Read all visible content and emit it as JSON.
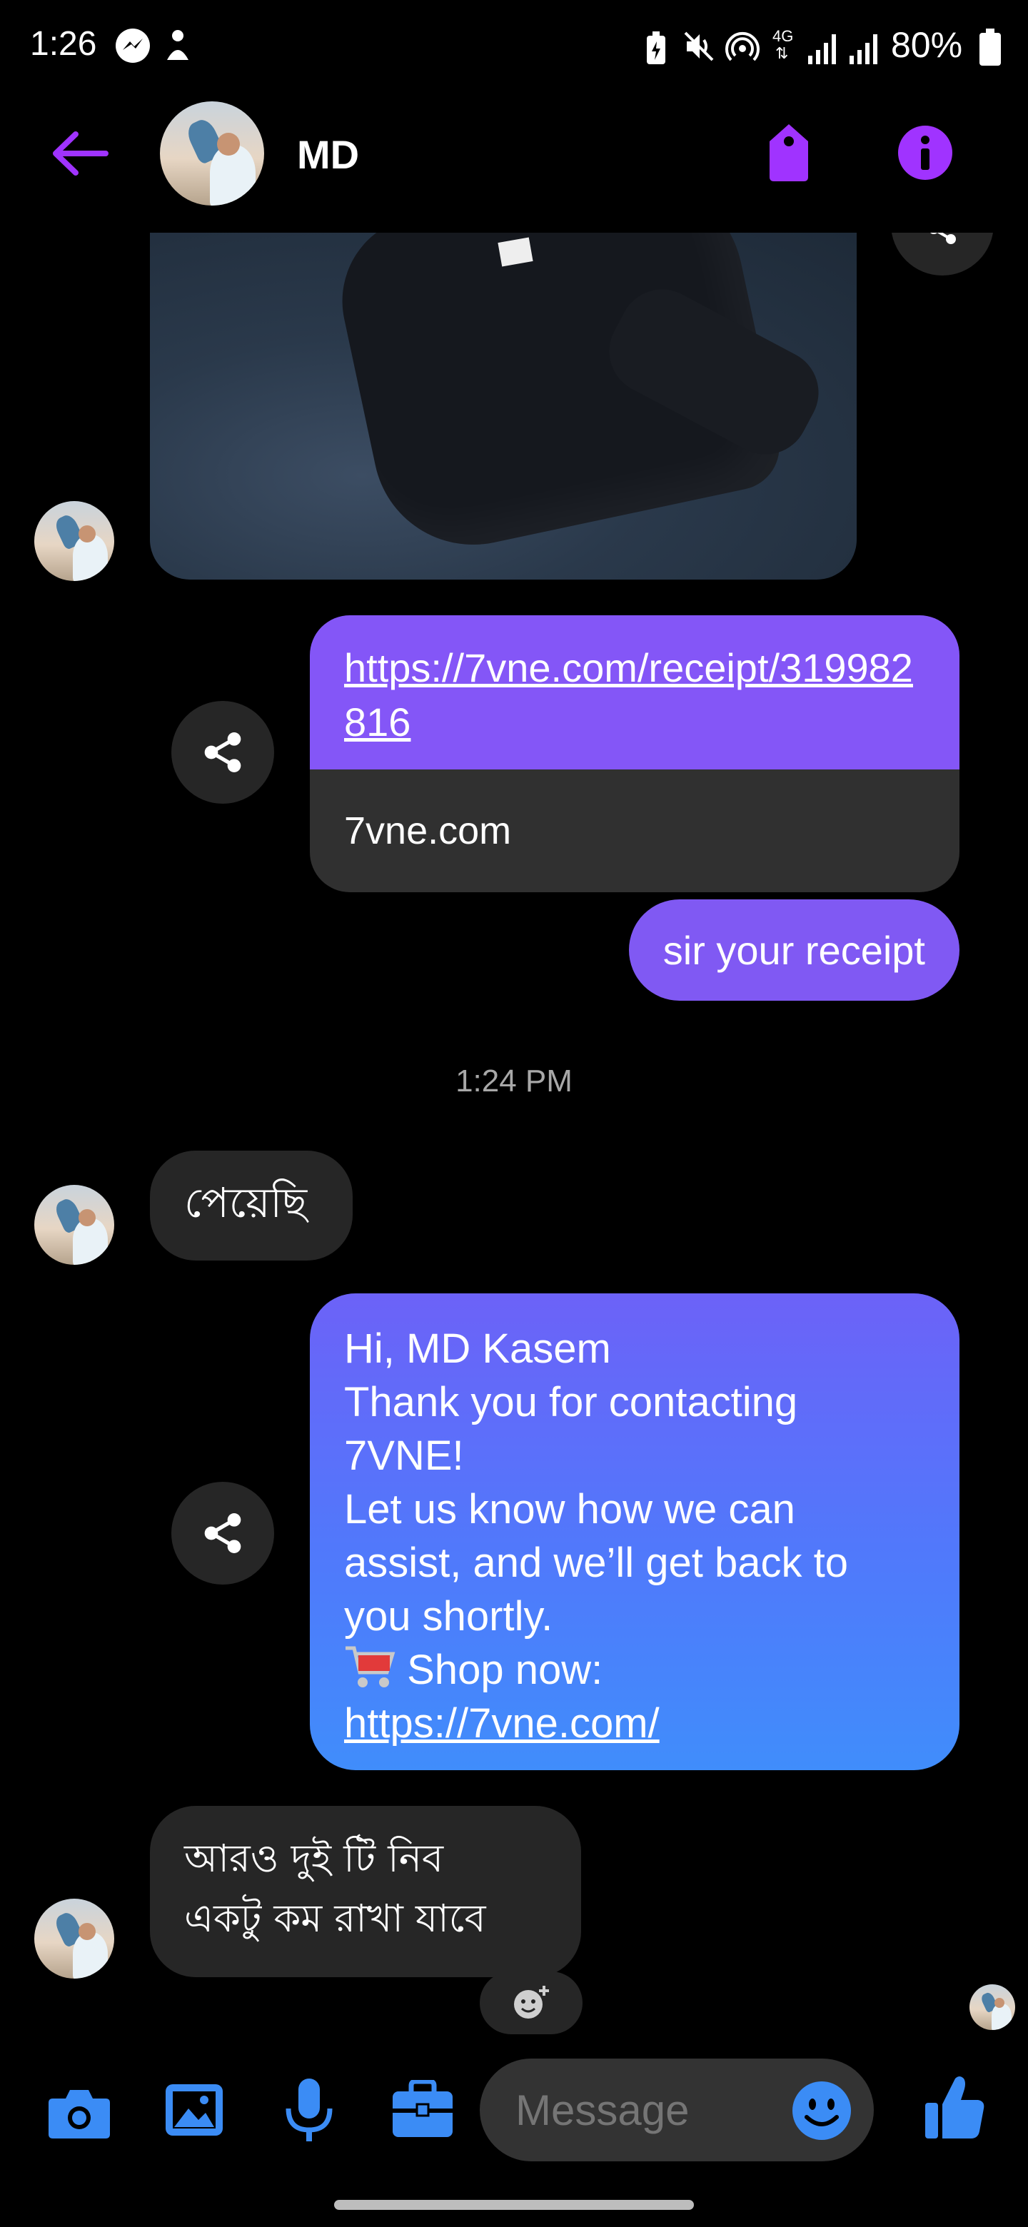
{
  "status_bar": {
    "time": "1:26",
    "network": "4G",
    "battery": "80%",
    "icons": [
      "messenger-icon",
      "figure-icon",
      "battery-saver-icon",
      "mute-icon",
      "hotspot-icon",
      "signal-icon",
      "signal-icon",
      "battery-icon"
    ]
  },
  "header": {
    "title": "MD",
    "back_icon": "arrow-left-icon",
    "tag_icon": "tag-icon",
    "info_icon": "info-icon"
  },
  "messages": {
    "link_url": "https://7vne.com/receipt/319982816",
    "link_domain": "7vne.com",
    "receipt_text": "sir your receipt",
    "timestamp": "1:24 PM",
    "reply_1": "পেয়েছি",
    "welcome": {
      "line1": "Hi, MD Kasem",
      "line2": "Thank you for contacting",
      "line3": "7VNE!",
      "line4": "Let us know how we can",
      "line5": "assist, and we’ll get back to",
      "line6": "you shortly.",
      "line7": "Shop now:",
      "line8": "https://7vne.com/"
    },
    "reply_2_line1": "আরও দুই টি নিব",
    "reply_2_line2": "একটু কম রাখা যাবে"
  },
  "composer": {
    "placeholder": "Message",
    "icons": [
      "camera-icon",
      "image-icon",
      "microphone-icon",
      "briefcase-icon",
      "emoji-icon",
      "thumbs-up-icon"
    ]
  },
  "colors": {
    "accent_purple": "#a033ff",
    "bubble_purple": "#8a55f9",
    "bubble_blue": "#408dfb",
    "composer_blue": "#3b8cf5",
    "bubble_grey": "#262626"
  }
}
